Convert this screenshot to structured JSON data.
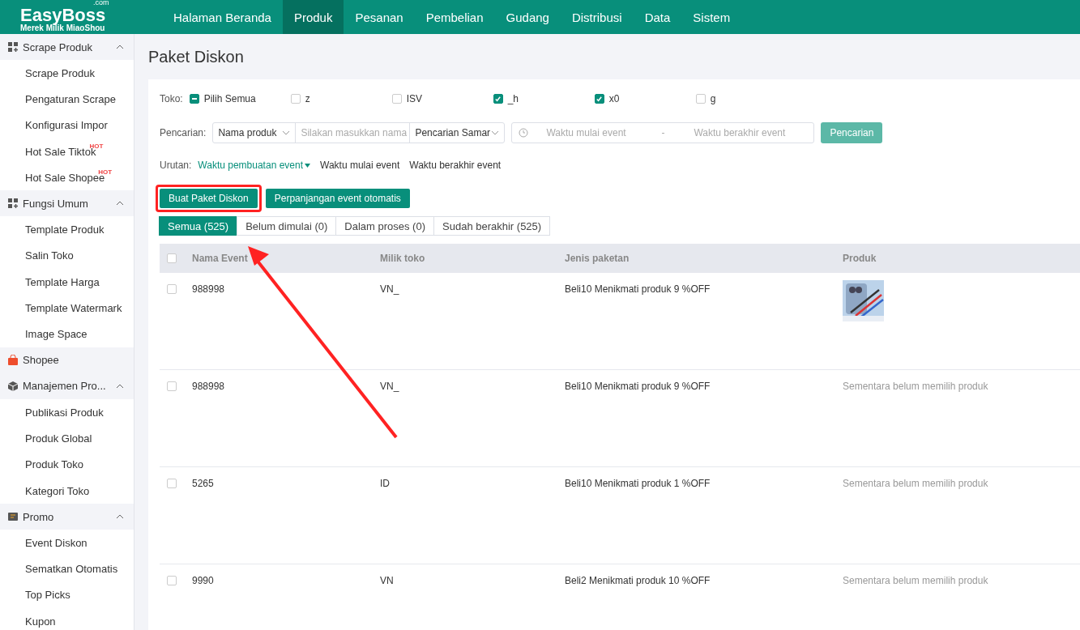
{
  "logo": {
    "brand": "EasyBoss",
    "suffix": ".com",
    "tagline": "Merek Milik MiaoShou"
  },
  "nav": [
    {
      "label": "Halaman Beranda",
      "selected": false
    },
    {
      "label": "Produk",
      "selected": true
    },
    {
      "label": "Pesanan",
      "selected": false
    },
    {
      "label": "Pembelian",
      "selected": false
    },
    {
      "label": "Gudang",
      "selected": false
    },
    {
      "label": "Distribusi",
      "selected": false
    },
    {
      "label": "Data",
      "selected": false
    },
    {
      "label": "Sistem",
      "selected": false
    }
  ],
  "sidebar": [
    {
      "label": "Scrape Produk",
      "kind": "grid",
      "expanded": true,
      "children": [
        {
          "label": "Scrape Produk"
        },
        {
          "label": "Pengaturan Scrape"
        },
        {
          "label": "Konfigurasi Impor"
        },
        {
          "label": "Hot Sale Tiktok",
          "badge": "HOT"
        },
        {
          "label": "Hot Sale Shopee",
          "badge": "HOT"
        }
      ]
    },
    {
      "label": "Fungsi Umum",
      "kind": "grid",
      "expanded": true,
      "children": [
        {
          "label": "Template Produk"
        },
        {
          "label": "Salin Toko"
        },
        {
          "label": "Template Harga"
        },
        {
          "label": "Template Watermark"
        },
        {
          "label": "Image Space"
        }
      ]
    },
    {
      "label": "Shopee",
      "kind": "bag"
    },
    {
      "label": "Manajemen Pro...",
      "kind": "cube",
      "expanded": true,
      "children": [
        {
          "label": "Publikasi Produk"
        },
        {
          "label": "Produk Global"
        },
        {
          "label": "Produk Toko"
        },
        {
          "label": "Kategori Toko"
        }
      ]
    },
    {
      "label": "Promo",
      "kind": "tag",
      "expanded": true,
      "children": [
        {
          "label": "Event Diskon"
        },
        {
          "label": "Sematkan Otomatis"
        },
        {
          "label": "Top Picks"
        },
        {
          "label": "Kupon"
        }
      ]
    }
  ],
  "page_title": "Paket Diskon",
  "filters": {
    "toko_label": "Toko:",
    "shops": [
      {
        "label": "Pilih Semua",
        "checked": true,
        "kind": "partial"
      },
      {
        "label": "z",
        "checked": false
      },
      {
        "label": "ISV",
        "checked": false
      },
      {
        "label": "_h",
        "checked": true
      },
      {
        "label": "x0",
        "checked": true
      },
      {
        "label": "g",
        "checked": false
      }
    ],
    "search_label": "Pencarian:",
    "search_field": "Nama produk",
    "search_placeholder": "Silakan masukkan nama",
    "match_mode": "Pencarian Samar",
    "start_placeholder": "Waktu mulai event",
    "range_separator": "-",
    "end_placeholder": "Waktu berakhir event",
    "search_button": "Pencarian",
    "sort_label": "Urutan:",
    "sorts": [
      {
        "label": "Waktu pembuatan event",
        "selected": true
      },
      {
        "label": "Waktu mulai event",
        "selected": false
      },
      {
        "label": "Waktu berakhir event",
        "selected": false
      }
    ]
  },
  "actions": [
    {
      "label": "Buat Paket Diskon",
      "highlighted": true
    },
    {
      "label": "Perpanjangan event otomatis",
      "highlighted": false
    }
  ],
  "status_tabs": [
    {
      "label": "Semua (525)",
      "selected": true
    },
    {
      "label": "Belum dimulai (0)",
      "selected": false
    },
    {
      "label": "Dalam proses (0)",
      "selected": false
    },
    {
      "label": "Sudah berakhir (525)",
      "selected": false
    }
  ],
  "table": {
    "header_checked": false,
    "columns": [
      "Nama Event",
      "Milik toko",
      "Jenis paketan",
      "Produk"
    ],
    "rows": [
      {
        "checked": false,
        "name": "988998",
        "shop": "VN_",
        "type": "Beli10 Menikmati produk 9 %OFF"
      },
      {
        "checked": false,
        "name": "988998",
        "shop": "VN_",
        "type": "Beli10 Menikmati produk 9 %OFF",
        "product": {
          "kind": "empty",
          "text": "Sementara belum memilih produk"
        }
      },
      {
        "checked": false,
        "name": "5265",
        "shop": "ID",
        "type": "Beli10 Menikmati produk 1 %OFF",
        "product": {
          "kind": "empty",
          "text": "Sementara belum memilih produk"
        }
      },
      {
        "checked": false,
        "name": "9990",
        "shop": "VN",
        "type": "Beli2 Menikmati produk 10 %OFF",
        "product": {
          "kind": "empty",
          "text": "Sementara belum memilih produk"
        }
      }
    ]
  }
}
